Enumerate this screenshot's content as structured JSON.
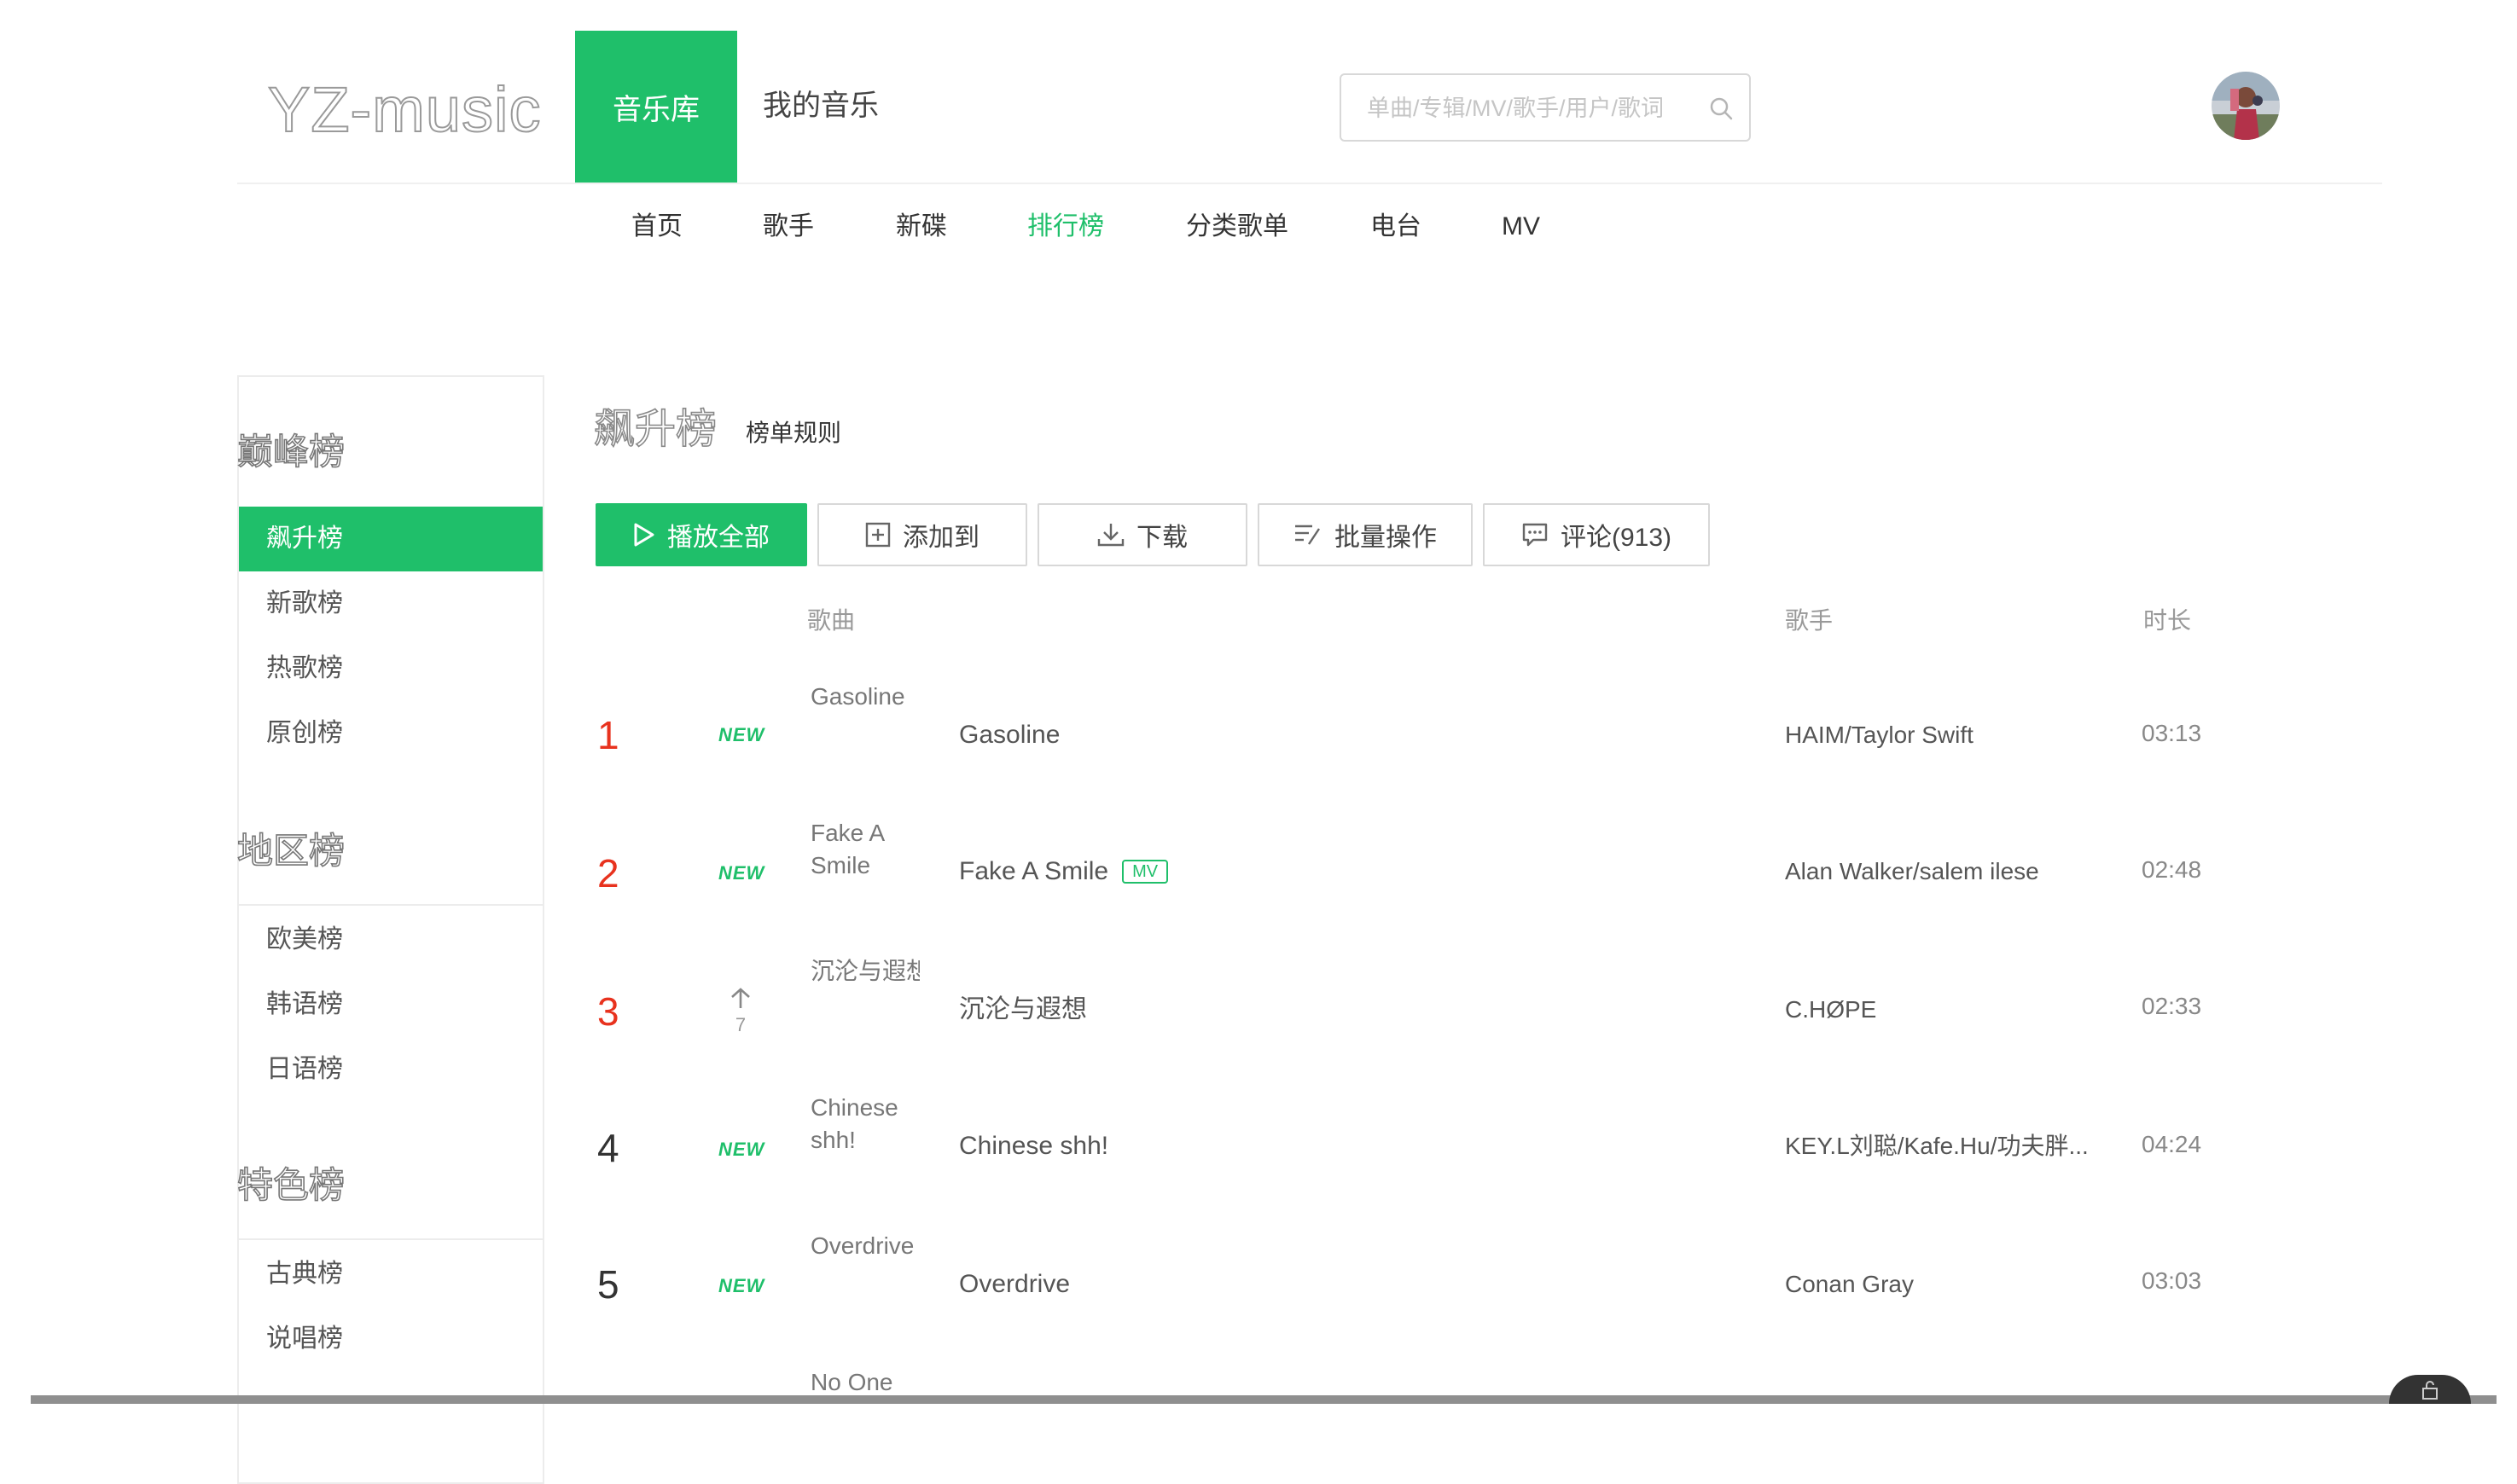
{
  "header": {
    "logo": "YZ-music",
    "nav": [
      {
        "label": "音乐库",
        "active": true
      },
      {
        "label": "我的音乐",
        "active": false
      }
    ],
    "search_placeholder": "单曲/专辑/MV/歌手/用户/歌词"
  },
  "subnav": [
    {
      "label": "首页"
    },
    {
      "label": "歌手"
    },
    {
      "label": "新碟"
    },
    {
      "label": "排行榜",
      "active": true
    },
    {
      "label": "分类歌单"
    },
    {
      "label": "电台"
    },
    {
      "label": "MV"
    }
  ],
  "sidebar": {
    "groups": [
      {
        "title": "巅峰榜",
        "items": [
          "飙升榜",
          "新歌榜",
          "热歌榜",
          "原创榜"
        ]
      },
      {
        "title": "地区榜",
        "items": [
          "欧美榜",
          "韩语榜",
          "日语榜"
        ]
      },
      {
        "title": "特色榜",
        "items": [
          "古典榜",
          "说唱榜"
        ]
      }
    ],
    "active_item": "飙升榜"
  },
  "chart": {
    "title": "飙升榜",
    "rule_link": "榜单规则"
  },
  "actions": {
    "play_all": "播放全部",
    "add_to": "添加到",
    "download": "下载",
    "batch": "批量操作",
    "comments": "评论(913)"
  },
  "columns": {
    "song": "歌曲",
    "singer": "歌手",
    "duration": "时长"
  },
  "songs": [
    {
      "rank": "1",
      "badge": "NEW",
      "trend_num": "",
      "cover_text": "Gasoline",
      "title": "Gasoline",
      "mv": "",
      "singer": "HAIM/Taylor Swift",
      "duration": "03:13"
    },
    {
      "rank": "2",
      "badge": "NEW",
      "trend_num": "",
      "cover_text": "Fake A Smile",
      "title": "Fake A Smile",
      "mv": "MV",
      "singer": "Alan Walker/salem ilese",
      "duration": "02:48"
    },
    {
      "rank": "3",
      "badge": "",
      "trend_num": "7",
      "cover_text": "沉沦与遐想",
      "title": "沉沦与遐想",
      "mv": "",
      "singer": "C.HØPE",
      "duration": "02:33"
    },
    {
      "rank": "4",
      "badge": "NEW",
      "trend_num": "",
      "cover_text": "Chinese shh!",
      "title": "Chinese shh!",
      "mv": "",
      "singer": "KEY.L刘聪/Kafe.Hu/功夫胖...",
      "duration": "04:24"
    },
    {
      "rank": "5",
      "badge": "NEW",
      "trend_num": "",
      "cover_text": "Overdrive",
      "title": "Overdrive",
      "mv": "",
      "singer": "Conan Gray",
      "duration": "03:03"
    },
    {
      "rank": "",
      "badge": "",
      "trend_num": "",
      "cover_text": "No One",
      "title": "",
      "mv": "",
      "singer": "",
      "duration": ""
    }
  ],
  "colors": {
    "accent": "#1fbf6a",
    "rank_top": "#e8321e"
  }
}
